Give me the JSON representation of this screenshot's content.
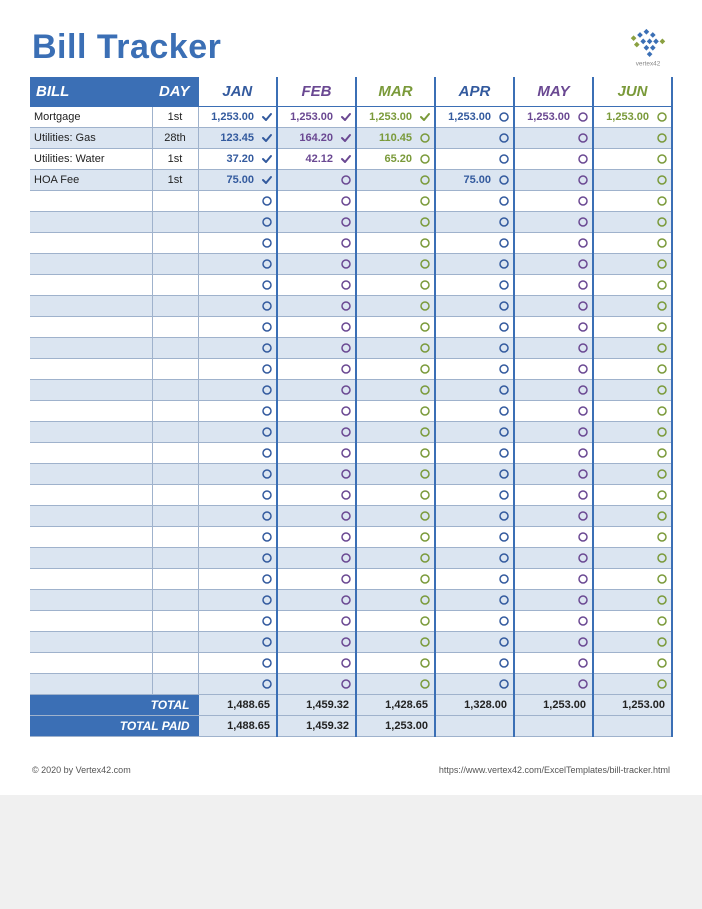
{
  "title": "Bill Tracker",
  "brand": "vertex42",
  "headers": {
    "bill": "BILL",
    "day": "DAY",
    "months": [
      "JAN",
      "FEB",
      "MAR",
      "APR",
      "MAY",
      "JUN"
    ]
  },
  "month_classes": [
    "c1",
    "c2",
    "c3",
    "c1",
    "c2",
    "c3"
  ],
  "colors": {
    "c1": "#335a9e",
    "c2": "#6a4892",
    "c3": "#7a9a3a"
  },
  "row_count": 28,
  "rows": [
    {
      "name": "Mortgage",
      "day": "1st",
      "months": [
        {
          "amount": "1,253.00",
          "paid": true
        },
        {
          "amount": "1,253.00",
          "paid": true
        },
        {
          "amount": "1,253.00",
          "paid": true
        },
        {
          "amount": "1,253.00",
          "paid": false
        },
        {
          "amount": "1,253.00",
          "paid": false
        },
        {
          "amount": "1,253.00",
          "paid": false
        }
      ]
    },
    {
      "name": "Utilities: Gas",
      "day": "28th",
      "months": [
        {
          "amount": "123.45",
          "paid": true
        },
        {
          "amount": "164.20",
          "paid": true
        },
        {
          "amount": "110.45",
          "paid": false
        },
        {
          "amount": "",
          "paid": false
        },
        {
          "amount": "",
          "paid": false
        },
        {
          "amount": "",
          "paid": false
        }
      ]
    },
    {
      "name": "Utilities: Water",
      "day": "1st",
      "months": [
        {
          "amount": "37.20",
          "paid": true
        },
        {
          "amount": "42.12",
          "paid": true
        },
        {
          "amount": "65.20",
          "paid": false
        },
        {
          "amount": "",
          "paid": false
        },
        {
          "amount": "",
          "paid": false
        },
        {
          "amount": "",
          "paid": false
        }
      ]
    },
    {
      "name": "HOA Fee",
      "day": "1st",
      "months": [
        {
          "amount": "75.00",
          "paid": true
        },
        {
          "amount": "",
          "paid": false
        },
        {
          "amount": "",
          "paid": false
        },
        {
          "amount": "75.00",
          "paid": false
        },
        {
          "amount": "",
          "paid": false
        },
        {
          "amount": "",
          "paid": false
        }
      ]
    }
  ],
  "totals": {
    "label_total": "TOTAL",
    "label_paid": "TOTAL PAID",
    "total": [
      "1,488.65",
      "1,459.32",
      "1,428.65",
      "1,328.00",
      "1,253.00",
      "1,253.00"
    ],
    "paid": [
      "1,488.65",
      "1,459.32",
      "1,253.00",
      "",
      "",
      ""
    ]
  },
  "footer": {
    "left": "© 2020 by Vertex42.com",
    "right": "https://www.vertex42.com/ExcelTemplates/bill-tracker.html"
  }
}
